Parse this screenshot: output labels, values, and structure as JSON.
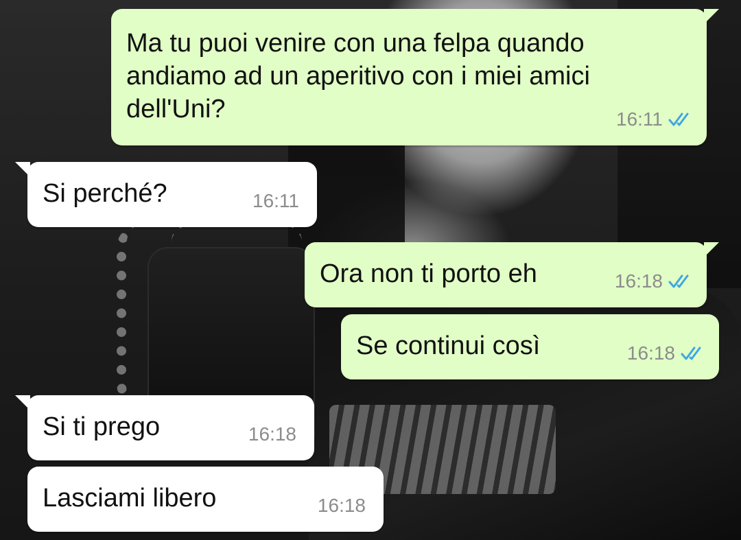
{
  "theme": {
    "outgoing_bg": "#e1fec6",
    "incoming_bg": "#ffffff",
    "tick_color": "#3fa7e0",
    "time_color": "#8c8c8c"
  },
  "messages": [
    {
      "direction": "outgoing",
      "text": "Ma tu puoi venire con una felpa quando\nandiamo ad un aperitivo con i miei amici\ndell'Uni?",
      "time": "16:11",
      "status_icon": "double-check-read-icon"
    },
    {
      "direction": "incoming",
      "text": "Si perché?",
      "time": "16:11"
    },
    {
      "direction": "outgoing",
      "text": "Ora non ti porto eh",
      "time": "16:18",
      "status_icon": "double-check-read-icon"
    },
    {
      "direction": "outgoing",
      "text": "Se continui così",
      "time": "16:18",
      "status_icon": "double-check-read-icon"
    },
    {
      "direction": "incoming",
      "text": "Si ti prego",
      "time": "16:18"
    },
    {
      "direction": "incoming",
      "text": "Lasciami libero",
      "time": "16:18"
    }
  ]
}
